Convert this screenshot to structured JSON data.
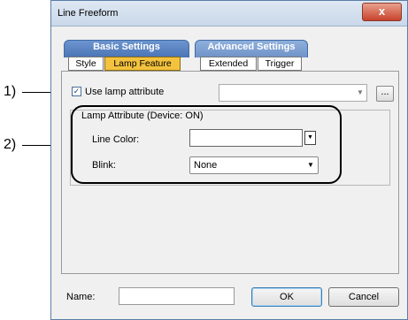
{
  "window": {
    "title": "Line Freeform",
    "close_glyph": "x"
  },
  "group_tabs": [
    {
      "label": "Basic Settings"
    },
    {
      "label": "Advanced Settings"
    }
  ],
  "sub_tabs": [
    {
      "label": "Style"
    },
    {
      "label": "Lamp Feature"
    },
    {
      "label": "Extended"
    },
    {
      "label": "Trigger"
    }
  ],
  "use_lamp": {
    "label": "Use lamp attribute",
    "checked": true,
    "check_glyph": "✓",
    "combo_value": "",
    "dots_label": "..."
  },
  "lamp_group": {
    "title": "Lamp Attribute (Device: ON)",
    "line_color_label": "Line Color:",
    "line_color_value": "",
    "blink_label": "Blink:",
    "blink_value": "None"
  },
  "footer": {
    "name_label": "Name:",
    "name_value": "",
    "ok_label": "OK",
    "cancel_label": "Cancel"
  },
  "callouts": {
    "one": "1)",
    "two": "2)"
  },
  "colors": {
    "selected_tab": "#f3c23e",
    "group_tab": "#4a74b5"
  }
}
